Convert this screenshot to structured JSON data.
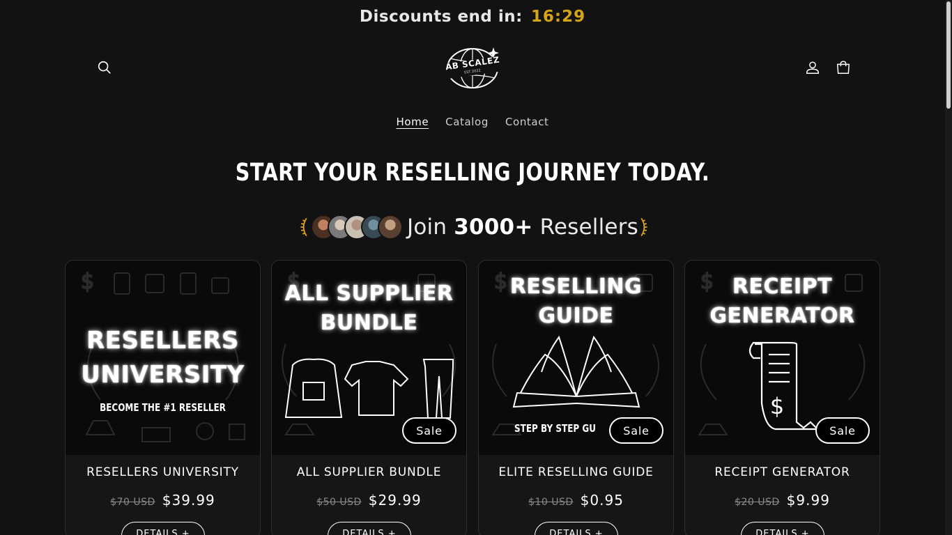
{
  "announcement": {
    "label": "Discounts end in:",
    "timer": "16:29"
  },
  "header": {
    "logo_text": "AB SCALEZ",
    "logo_sub": "EST 2022",
    "icons": [
      "search-icon",
      "account-icon",
      "cart-icon"
    ]
  },
  "nav": {
    "items": [
      {
        "label": "Home"
      },
      {
        "label": "Catalog"
      },
      {
        "label": "Contact"
      }
    ]
  },
  "hero": {
    "title": "START YOUR RESELLING JOURNEY TODAY.",
    "join_prefix": "Join",
    "join_count": "3000+",
    "join_suffix": "Resellers"
  },
  "products": [
    {
      "image_title_1": "RESELLERS",
      "image_title_2": "UNIVERSITY",
      "image_sub": "BECOME THE #1 RESELLER",
      "name": "RESELLERS UNIVERSITY",
      "old_price": "$70 USD",
      "price": "$39.99",
      "button": "DETAILS +"
    },
    {
      "image_title_1": "ALL SUPPLIER",
      "image_title_2": "BUNDLE",
      "sale": "Sale",
      "name": "ALL SUPPLIER BUNDLE",
      "old_price": "$50 USD",
      "price": "$29.99",
      "button": "DETAILS +"
    },
    {
      "image_title_1": "RESELLING",
      "image_title_2": "GUIDE",
      "image_sub": "STEP BY STEP GU",
      "sale": "Sale",
      "name": "ELITE RESELLING GUIDE",
      "old_price": "$10 USD",
      "price": "$0.95",
      "button": "DETAILS +"
    },
    {
      "image_title_1": "RECEIPT",
      "image_title_2": "GENERATOR",
      "sale": "Sale",
      "name": "RECEIPT GENERATOR",
      "old_price": "$20 USD",
      "price": "$9.99",
      "button": "DETAILS +"
    }
  ],
  "colors": {
    "background": "#121212",
    "timer": "#d4a514",
    "laurel": "#e0a526"
  }
}
